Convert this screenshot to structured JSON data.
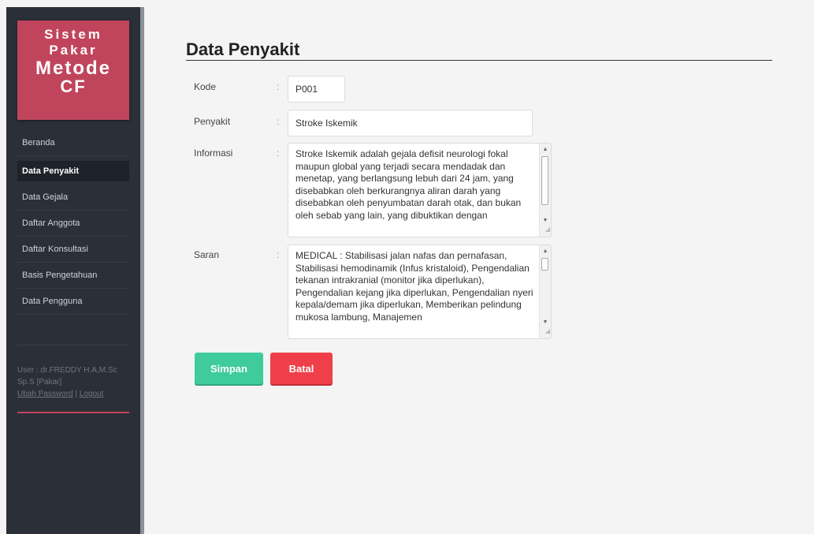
{
  "logo": {
    "line1": "Sistem",
    "line2": "Pakar",
    "line3": "Metode",
    "line4": "CF"
  },
  "nav": [
    {
      "label": "Beranda"
    },
    {
      "label": "Data Penyakit"
    },
    {
      "label": "Data Gejala"
    },
    {
      "label": "Daftar Anggota"
    },
    {
      "label": "Daftar Konsultasi"
    },
    {
      "label": "Basis Pengetahuan"
    },
    {
      "label": "Data Pengguna"
    }
  ],
  "nav_active": "Data Penyakit",
  "user": {
    "line1": "User : dr.FREDDY H.A,M.Sc",
    "line2": "Sp.S [Pakar]",
    "change_password": "Ubah Password",
    "separator": "|",
    "logout": "Logout"
  },
  "page": {
    "title": "Data Penyakit"
  },
  "form": {
    "colon": ":",
    "kode": {
      "label": "Kode",
      "value": "P001"
    },
    "penyakit": {
      "label": "Penyakit",
      "value": "Stroke Iskemik"
    },
    "informasi": {
      "label": "Informasi",
      "value": "Stroke Iskemik adalah gejala defisit neurologi fokal maupun global yang terjadi secara mendadak dan menetap, yang berlangsung lebuh dari 24 jam, yang disebabkan oleh berkurangnya aliran darah yang disebabkan oleh penyumbatan darah otak, dan bukan oleh sebab yang lain, yang dibuktikan dengan"
    },
    "saran": {
      "label": "Saran",
      "value": "MEDICAL : Stabilisasi jalan nafas dan pernafasan, Stabilisasi hemodinamik (Infus kristaloid), Pengendalian tekanan intrakranial (monitor jika diperlukan), Pengendalian kejang jika diperlukan, Pengendalian nyeri kepala/demam jika diperlukan, Memberikan pelindung mukosa lambung, Manajemen"
    }
  },
  "buttons": {
    "save": "Simpan",
    "cancel": "Batal"
  },
  "icons": {
    "scroll_up": "scroll-up-arrow-icon",
    "scroll_down": "scroll-down-arrow-icon",
    "resize": "resize-grip-icon"
  },
  "colors": {
    "logo_bg": "#c0455c",
    "save": "#3fcb9b",
    "cancel": "#ee3f4a",
    "sidebar": "#2b2f38"
  }
}
